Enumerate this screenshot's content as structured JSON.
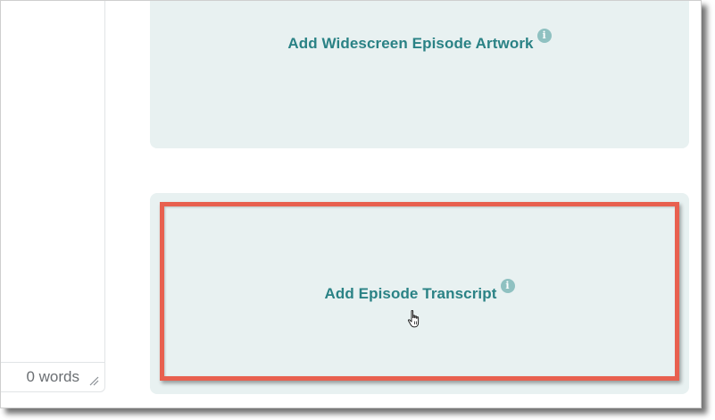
{
  "editor": {
    "word_count": "0 words"
  },
  "cards": {
    "artwork": {
      "label": "Add Widescreen Episode Artwork",
      "info_icon_text": "i"
    },
    "transcript": {
      "label": "Add Episode Transcript",
      "info_icon_text": "i"
    }
  },
  "icons": {
    "info": "info-icon",
    "resize": "resize-handle-icon",
    "cursor": "hand-pointer-icon"
  },
  "colors": {
    "accent_text": "#2a8285",
    "card_background": "#e8f1f1",
    "info_icon": "#8fc1c1",
    "highlight": "#e8604f"
  }
}
